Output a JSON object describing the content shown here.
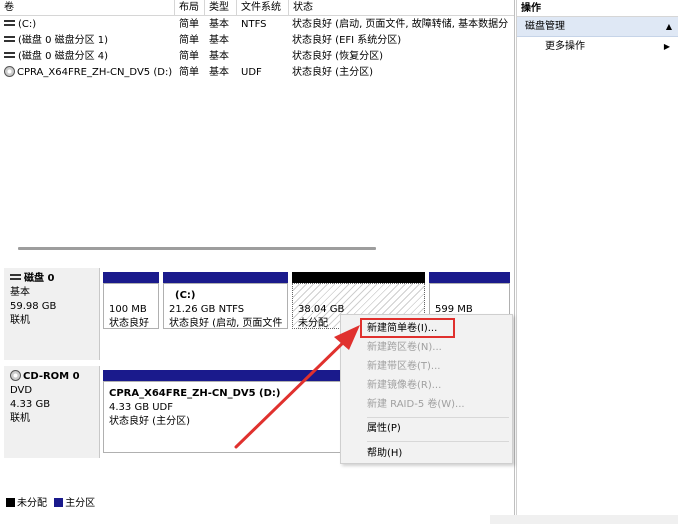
{
  "volume_list": {
    "columns": [
      "卷",
      "布局",
      "类型",
      "文件系统",
      "状态"
    ],
    "rows": [
      {
        "name": "(C:)",
        "icon": "drive-icon",
        "layout": "简单",
        "type": "基本",
        "fs": "NTFS",
        "status": "状态良好 (启动, 页面文件, 故障转储, 基本数据分"
      },
      {
        "name": "(磁盘 0 磁盘分区 1)",
        "icon": "drive-icon",
        "layout": "简单",
        "type": "基本",
        "fs": "",
        "status": "状态良好 (EFI 系统分区)"
      },
      {
        "name": "(磁盘 0 磁盘分区 4)",
        "icon": "drive-icon",
        "layout": "简单",
        "type": "基本",
        "fs": "",
        "status": "状态良好 (恢复分区)"
      },
      {
        "name": "CPRA_X64FRE_ZH-CN_DV5 (D:)",
        "icon": "cd-icon",
        "layout": "简单",
        "type": "基本",
        "fs": "UDF",
        "status": "状态良好 (主分区)"
      }
    ]
  },
  "disks": [
    {
      "label": "磁盘 0",
      "kind": "基本",
      "size": "59.98 GB",
      "state": "联机",
      "icon": "drive-icon",
      "partitions": [
        {
          "line1": "",
          "line2": "100 MB",
          "line3": "状态良好"
        },
        {
          "line1": "(C:)",
          "line2": "21.26 GB NTFS",
          "line3": "状态良好 (启动, 页面文件"
        },
        {
          "line1": "",
          "line2": "38.04 GB",
          "line3": "未分配"
        },
        {
          "line1": "",
          "line2": "599 MB",
          "line3": ""
        }
      ]
    },
    {
      "label": "CD-ROM 0",
      "kind": "DVD",
      "size": "4.33 GB",
      "state": "联机",
      "icon": "cd-icon",
      "partitions": [
        {
          "line1": "CPRA_X64FRE_ZH-CN_DV5  (D:)",
          "line2": "4.33 GB UDF",
          "line3": "状态良好 (主分区)"
        }
      ]
    }
  ],
  "legend": {
    "unallocated": "未分配",
    "primary": "主分区",
    "unallocated_color": "#000000",
    "primary_color": "#1a1a8c"
  },
  "actions": {
    "title": "操作",
    "section": "磁盘管理",
    "more": "更多操作"
  },
  "context_menu": {
    "items": [
      {
        "label": "新建简单卷(I)...",
        "enabled": true
      },
      {
        "label": "新建跨区卷(N)...",
        "enabled": false
      },
      {
        "label": "新建带区卷(T)...",
        "enabled": false
      },
      {
        "label": "新建镜像卷(R)...",
        "enabled": false
      },
      {
        "label": "新建 RAID-5 卷(W)...",
        "enabled": false
      },
      {
        "label": "属性(P)",
        "enabled": true
      },
      {
        "label": "帮助(H)",
        "enabled": true
      }
    ]
  },
  "colors": {
    "highlight": "#e0312e",
    "arrow": "#e0312e",
    "primary_bar": "#1a1a8c",
    "section_bg": "#dfe8f5"
  }
}
